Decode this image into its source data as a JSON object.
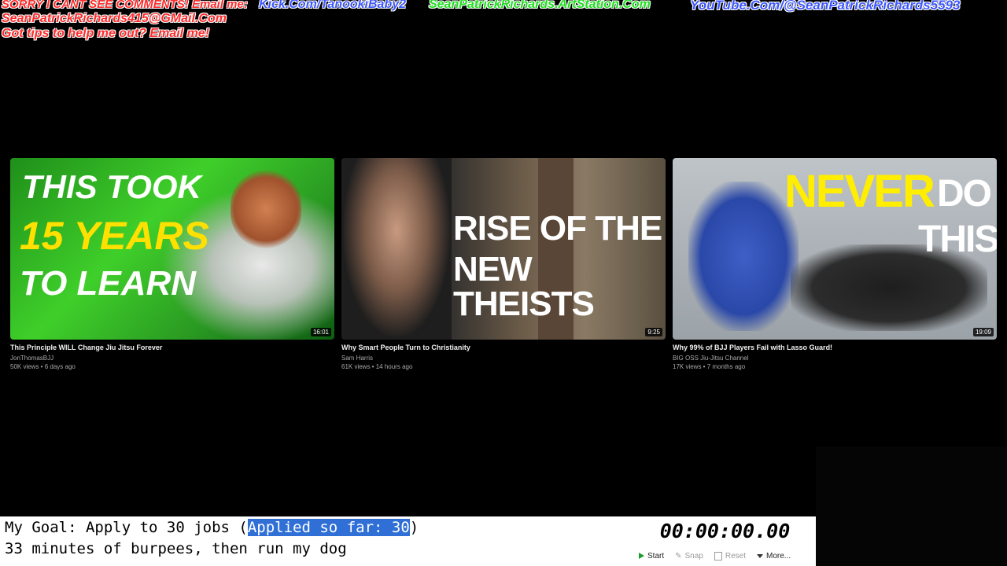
{
  "overlay": {
    "line1_red": "SORRY I CANT SEE COMMENTS! Email me:",
    "kick": "Kick.Com/TanookiBaby2",
    "artstation": "SeanPatrickRichards.ArtStation.Com",
    "youtube": "YouTube.Com/@SeanPatrickRichards5593",
    "email": "SeanPatrickRichards415@GMail.Com",
    "tips": "Got tips to help me out? Email me!"
  },
  "videos": [
    {
      "title": "This Principle WILL Change Jiu Jitsu Forever",
      "channel": "JonThomasBJJ",
      "meta": "50K views • 6 days ago",
      "duration": "16:01",
      "thumb_lines": [
        "THIS TOOK",
        "15 YEARS",
        "TO LEARN"
      ]
    },
    {
      "title": "Why Smart People Turn to Christianity",
      "channel": "Sam Harris",
      "meta": "61K views • 14 hours ago",
      "duration": "9:25",
      "thumb_lines": [
        "RISE OF THE",
        "NEW THEISTS"
      ]
    },
    {
      "title": "Why 99% of BJJ Players Fail with Lasso Guard!",
      "channel": "BIG OSS Jiu-Jitsu Channel",
      "meta": "17K views • 7 months ago",
      "duration": "19:09",
      "thumb_lines": [
        "NEVER",
        "DO",
        "THIS!"
      ]
    }
  ],
  "goal": {
    "prefix": "My Goal: Apply to 30 jobs (",
    "highlight": "Applied so far: 30",
    "suffix": ")",
    "line2": "33 minutes of burpees, then run my dog"
  },
  "timer": {
    "display": "00:00:00.00",
    "start": "Start",
    "snap": "Snap",
    "reset": "Reset",
    "more": "More..."
  }
}
